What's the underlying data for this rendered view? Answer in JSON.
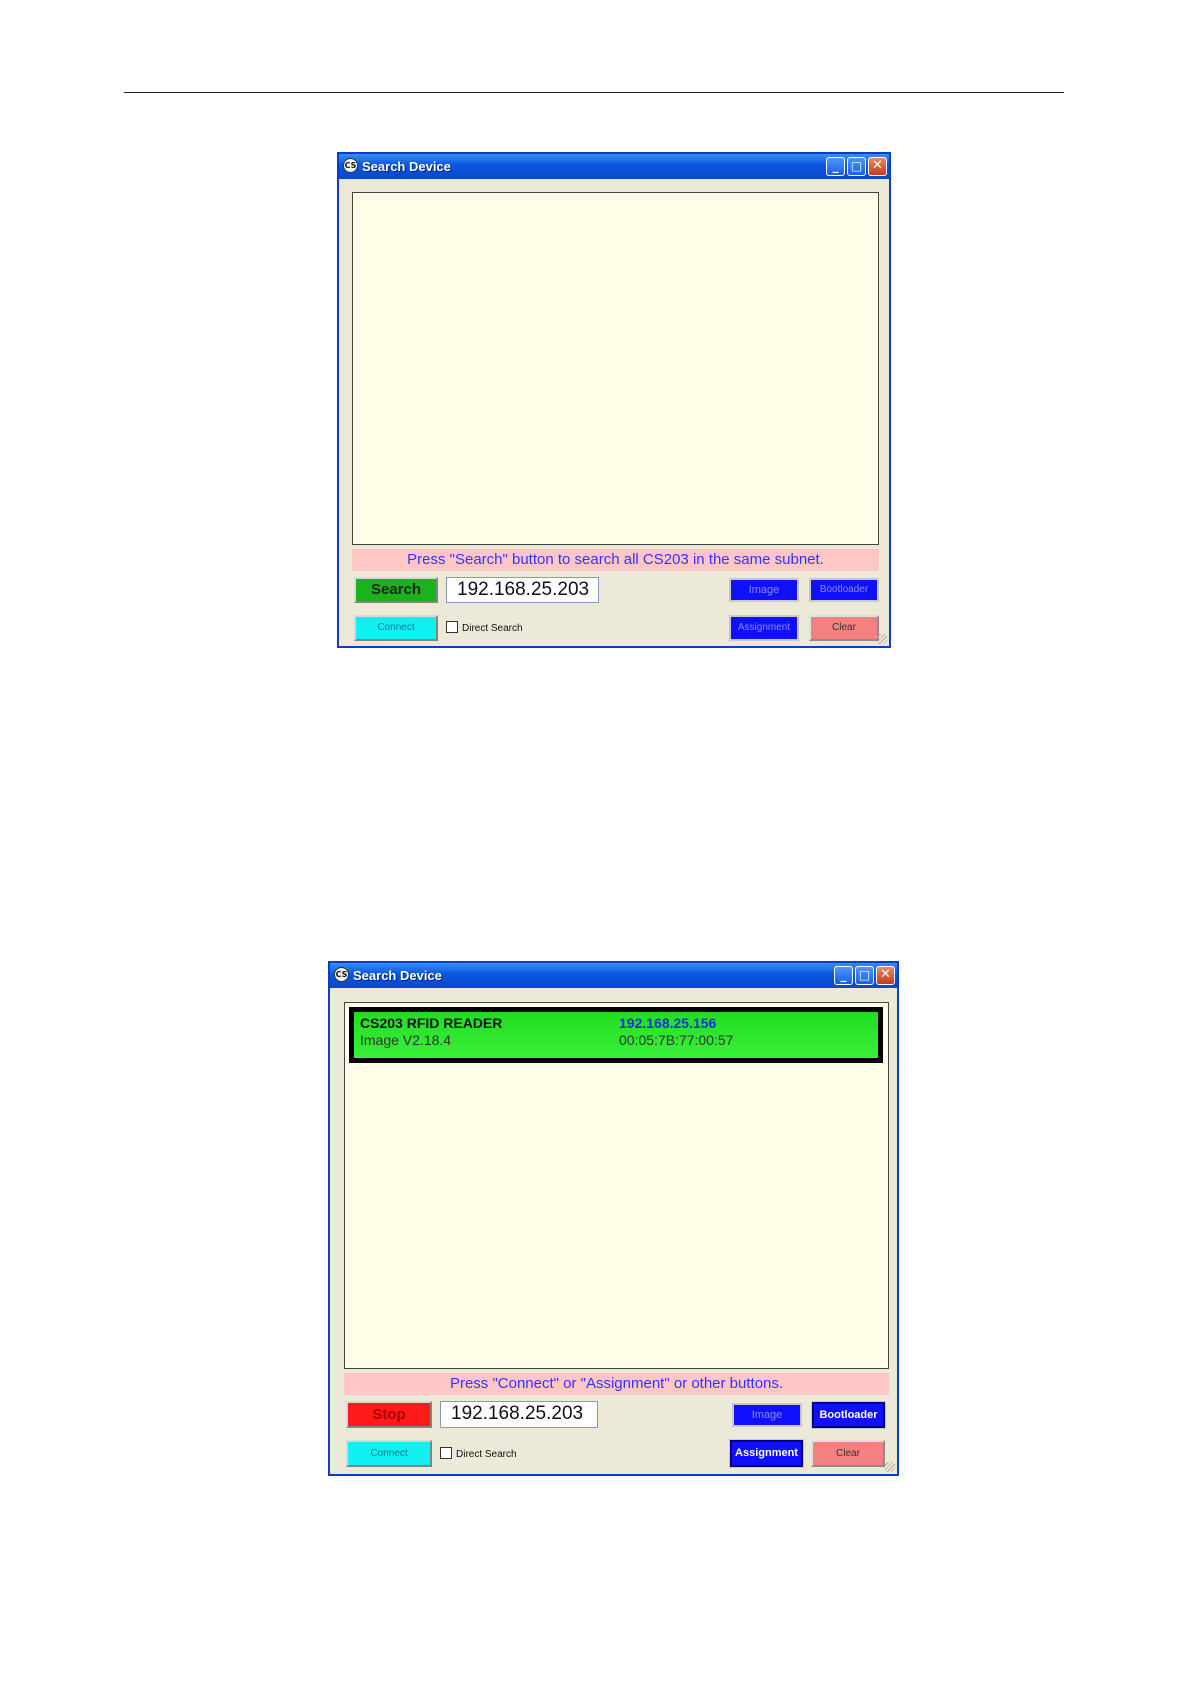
{
  "window1": {
    "title": "Search Device",
    "app_icon": "CS",
    "status_message": "Press \"Search\" button to search all CS203 in the same subnet.",
    "ip_value": "192.168.25.203",
    "buttons": {
      "search": "Search",
      "image": "Image",
      "bootloader": "Bootloader",
      "connect": "Connect",
      "assignment": "Assignment",
      "clear": "Clear"
    },
    "direct_search_label": "Direct Search",
    "direct_search_checked": false
  },
  "window2": {
    "title": "Search Device",
    "app_icon": "CS",
    "device": {
      "name": "CS203 RFID READER",
      "image_version": "Image V2.18.4",
      "ip": "192.168.25.156",
      "mac": "00:05:7B:77:00:57"
    },
    "status_message": "Press \"Connect\" or \"Assignment\" or other buttons.",
    "ip_value": "192.168.25.203",
    "buttons": {
      "stop": "Stop",
      "image": "Image",
      "bootloader": "Bootloader",
      "connect": "Connect",
      "assignment": "Assignment",
      "clear": "Clear"
    },
    "direct_search_label": "Direct Search",
    "direct_search_checked": false
  },
  "titlebar_buttons": {
    "minimize": "minimize-icon",
    "maximize": "maximize-icon",
    "close": "close-icon"
  },
  "colors": {
    "list_bg": "#fffde7",
    "status_bg": "#ffc6c6",
    "device_row": "#22dd22",
    "titlebar": "#0a56e0"
  }
}
